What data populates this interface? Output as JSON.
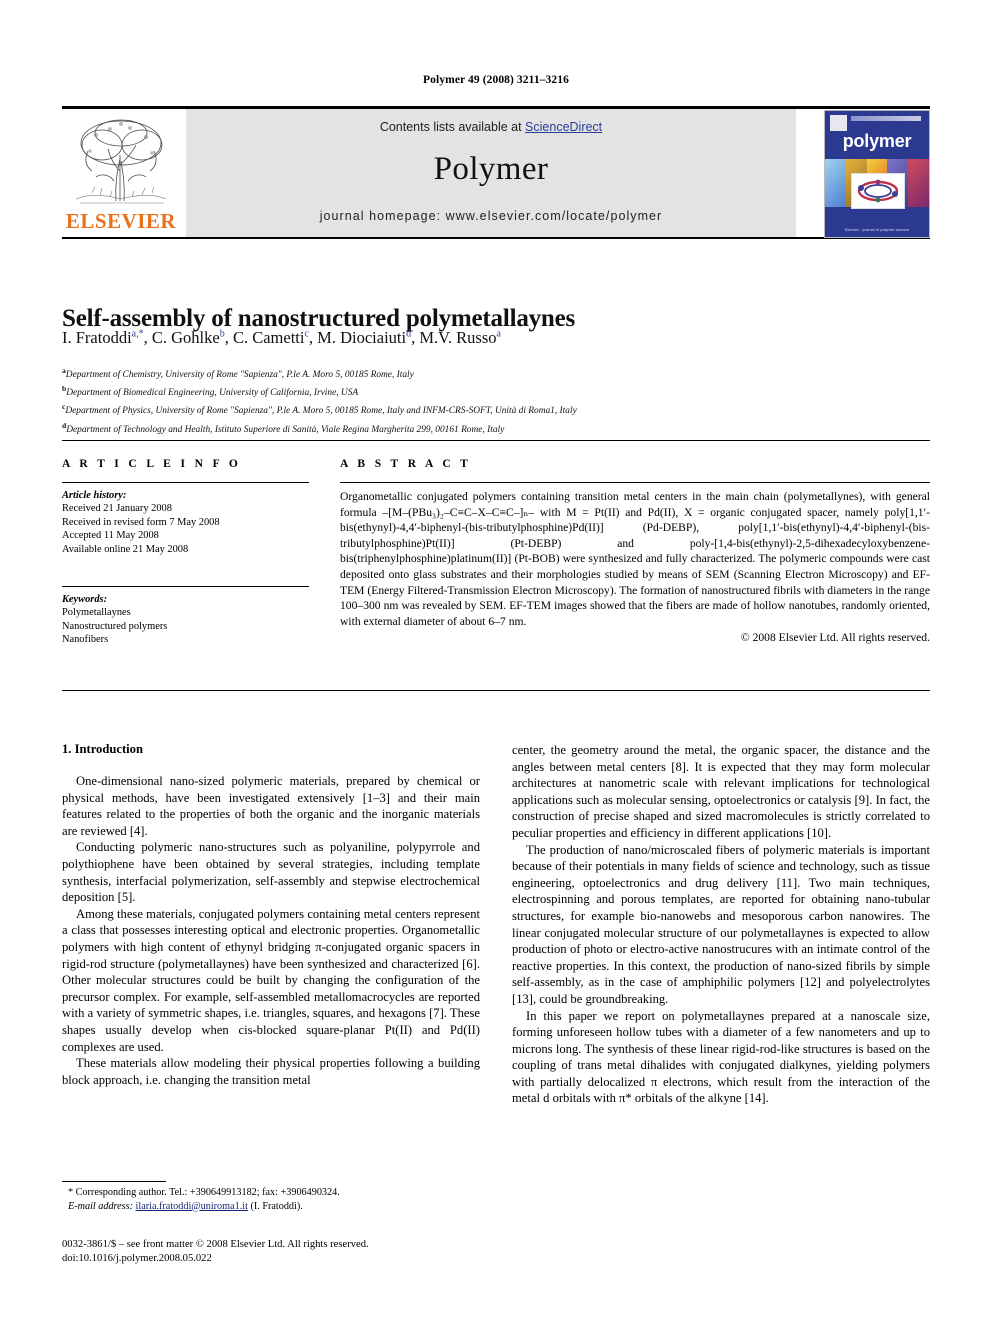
{
  "running_head": "Polymer 49 (2008) 3211–3216",
  "masthead": {
    "publisher_name": "ELSEVIER",
    "contents_prefix": "Contents lists available at ",
    "sciencedirect_link": "ScienceDirect",
    "journal_name": "Polymer",
    "homepage": "journal homepage: www.elsevier.com/locate/polymer",
    "cover_title": "polymer",
    "cover_footer": "Elsevier  ·  journal of polymer science",
    "brand_color": "#E9711C",
    "link_color": "#2b3c9c",
    "cover_background": "#2b3990",
    "band_background": "#e3e3e3"
  },
  "article": {
    "title": "Self-assembly of nanostructured polymetallaynes",
    "authors": [
      {
        "name": "I. Fratoddi",
        "marks": "a,*"
      },
      {
        "name": "C. Gohlke",
        "marks": "b"
      },
      {
        "name": "C. Cametti",
        "marks": "c"
      },
      {
        "name": "M. Diociaiuti",
        "marks": "d"
      },
      {
        "name": "M.V. Russo",
        "marks": "a"
      }
    ],
    "affiliations": [
      {
        "mark": "a",
        "text": "Department of Chemistry, University of Rome \"Sapienza\", P.le A. Moro 5, 00185 Rome, Italy"
      },
      {
        "mark": "b",
        "text": "Department of Biomedical Engineering, University of California, Irvine, USA"
      },
      {
        "mark": "c",
        "text": "Department of Physics, University of Rome \"Sapienza\", P.le A. Moro 5, 00185 Rome, Italy and INFM-CRS-SOFT, Unità di Roma1, Italy"
      },
      {
        "mark": "d",
        "text": "Department of Technology and Health, Istituto Superiore di Sanità, Viale Regina Margherita 299, 00161 Rome, Italy"
      }
    ]
  },
  "article_info": {
    "heading": "A R T I C L E   I N F O",
    "history_label": "Article history:",
    "history": [
      "Received 21 January 2008",
      "Received in revised form 7 May 2008",
      "Accepted 11 May 2008",
      "Available online 21 May 2008"
    ],
    "keywords_label": "Keywords:",
    "keywords": [
      "Polymetallaynes",
      "Nanostructured polymers",
      "Nanofibers"
    ]
  },
  "abstract": {
    "heading": "A B S T R A C T",
    "text": "Organometallic conjugated polymers containing transition metal centers in the main chain (polymetallynes), with general formula –[M–(PBu₃)₂–C≡C–X–C≡C–]ₙ– with M = Pt(II) and Pd(II), X = organic conjugated spacer, namely poly[1,1′-bis(ethynyl)-4,4′-biphenyl-(bis-tributylphosphine)Pd(II)] (Pd-DEBP), poly[1,1′-bis(ethynyl)-4,4′-biphenyl-(bis-tributylphosphine)Pt(II)] (Pt-DEBP) and poly-[1,4-bis(ethynyl)-2,5-dihexadecyloxybenzene-bis(triphenylphosphine)platinum(II)] (Pt-BOB) were synthesized and fully characterized. The polymeric compounds were cast deposited onto glass substrates and their morphologies studied by means of SEM (Scanning Electron Microscopy) and EF-TEM (Energy Filtered-Transmission Electron Microscopy). The formation of nanostructured fibrils with diameters in the range 100–300 nm was revealed by SEM. EF-TEM images showed that the fibers are made of hollow nanotubes, randomly oriented, with external diameter of about 6–7 nm.",
    "copyright": "© 2008 Elsevier Ltd. All rights reserved."
  },
  "body": {
    "section_heading": "1. Introduction",
    "left_paragraphs": [
      "One-dimensional nano-sized polymeric materials, prepared by chemical or physical methods, have been investigated extensively [1–3] and their main features related to the properties of both the organic and the inorganic materials are reviewed [4].",
      "Conducting polymeric nano-structures such as polyaniline, polypyrrole and polythiophene have been obtained by several strategies, including template synthesis, interfacial polymerization, self-assembly and stepwise electrochemical deposition [5].",
      "Among these materials, conjugated polymers containing metal centers represent a class that possesses interesting optical and electronic properties. Organometallic polymers with high content of ethynyl bridging π-conjugated organic spacers in rigid-rod structure (polymetallaynes) have been synthesized and characterized [6]. Other molecular structures could be built by changing the configuration of the precursor complex. For example, self-assembled metallomacrocycles are reported with a variety of symmetric shapes, i.e. triangles, squares, and hexagons [7]. These shapes usually develop when cis-blocked square-planar Pt(II) and Pd(II) complexes are used.",
      "These materials allow modeling their physical properties following a building block approach, i.e. changing the transition metal"
    ],
    "right_paragraphs": [
      "center, the geometry around the metal, the organic spacer, the distance and the angles between metal centers [8]. It is expected that they may form molecular architectures at nanometric scale with relevant implications for technological applications such as molecular sensing, optoelectronics or catalysis [9]. In fact, the construction of precise shaped and sized macromolecules is strictly correlated to peculiar properties and efficiency in different applications [10].",
      "The production of nano/microscaled fibers of polymeric materials is important because of their potentials in many fields of science and technology, such as tissue engineering, optoelectronics and drug delivery [11]. Two main techniques, electrospinning and porous templates, are reported for obtaining nano-tubular structures, for example bio-nanowebs and mesoporous carbon nanowires. The linear conjugated molecular structure of our polymetallaynes is expected to allow production of photo or electro-active nanostrucures with an intimate control of the reactive properties. In this context, the production of nano-sized fibrils by simple self-assembly, as in the case of amphiphilic polymers [12] and polyelectrolytes [13], could be groundbreaking.",
      "In this paper we report on polymetallaynes prepared at a nanoscale size, forming unforeseen hollow tubes with a diameter of a few nanometers and up to microns long. The synthesis of these linear rigid-rod-like structures is based on the coupling of trans metal dihalides with conjugated dialkynes, yielding polymers with partially delocalized π electrons, which result from the interaction of the metal d orbitals with π* orbitals of the alkyne [14]."
    ]
  },
  "footnote": {
    "line1": "* Corresponding author. Tel.: +390649913182; fax: +3906490324.",
    "email_label": "E-mail address:",
    "email": "ilaria.fratoddi@uniroma1.it",
    "email_suffix": "(I. Fratoddi)."
  },
  "footer": {
    "line1": "0032-3861/$ – see front matter © 2008 Elsevier Ltd. All rights reserved.",
    "line2": "doi:10.1016/j.polymer.2008.05.022"
  }
}
